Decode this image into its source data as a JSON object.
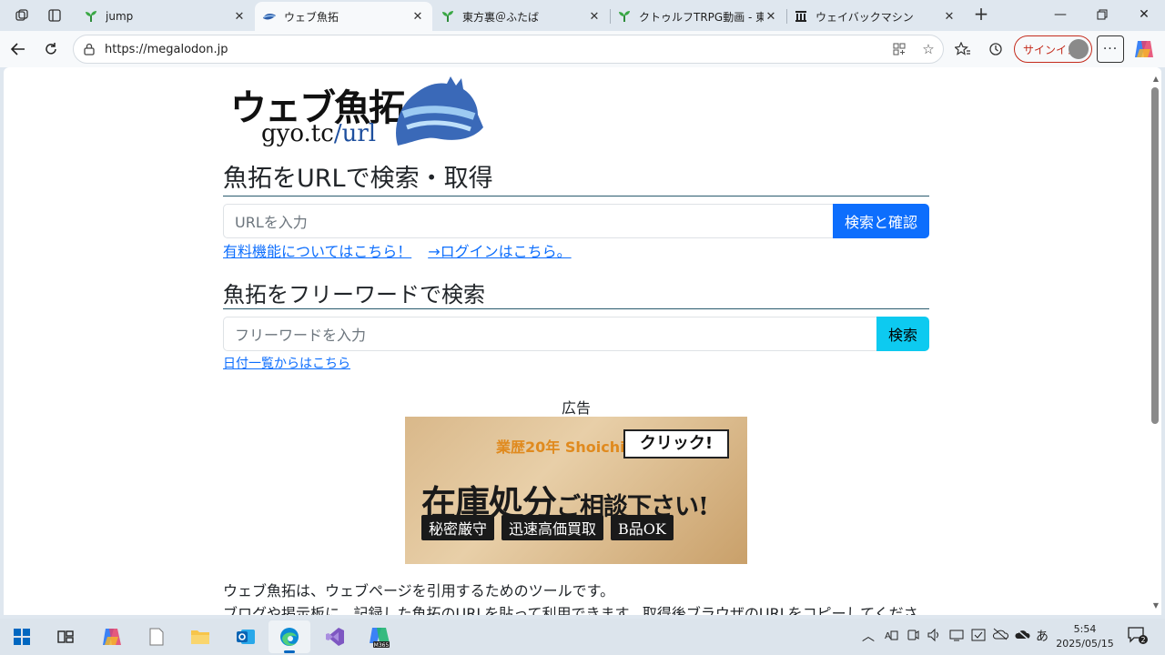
{
  "tabs": [
    {
      "label": "jump",
      "active": false
    },
    {
      "label": "ウェブ魚拓",
      "active": true
    },
    {
      "label": "東方裏＠ふたば",
      "active": false
    },
    {
      "label": "クトゥルフTRPG動画 - 東方",
      "active": false
    },
    {
      "label": "ウェイバックマシン",
      "active": false
    }
  ],
  "address_bar": {
    "url": "https://megalodon.jp"
  },
  "toolbar": {
    "signin_label": "サインイン"
  },
  "page": {
    "logo_text": "ウェブ魚拓",
    "logo_sub": "gyo.tc",
    "logo_sub_slash": "/url",
    "url_section_title": "魚拓をURLで検索・取得",
    "url_input_placeholder": "URLを入力",
    "url_search_button": "検索と確認",
    "paid_features_link": "有料機能についてはこちら！",
    "login_link": "→ログインはこちら。",
    "freeword_section_title": "魚拓をフリーワードで検索",
    "freeword_input_placeholder": "フリーワードを入力",
    "freeword_search_button": "検索",
    "date_list_link": "日付一覧からはこちら",
    "ad_label": "広告",
    "ad": {
      "brand": "業歴20年 Shoichi",
      "click": "クリック!",
      "main": "在庫処分",
      "main_small": "ご相談下さい!",
      "tags": [
        "秘密厳守",
        "迅速高価買取",
        "B品OK"
      ]
    },
    "description_line1": "ウェブ魚拓は、ウェブページを引用するためのツールです。",
    "description_line2": "ブログや掲示板に、記録した魚拓のURLを貼って利用できます。取得後ブラウザのURLをコピーしてくださ"
  },
  "taskbar": {
    "time": "5:54",
    "date": "2025/05/15",
    "notification_count": "2",
    "ime": "あ",
    "m365_label": "M365"
  },
  "colors": {
    "primary": "#0d6efd",
    "info": "#0dcaf0",
    "edge_blue": "#0067c0"
  }
}
